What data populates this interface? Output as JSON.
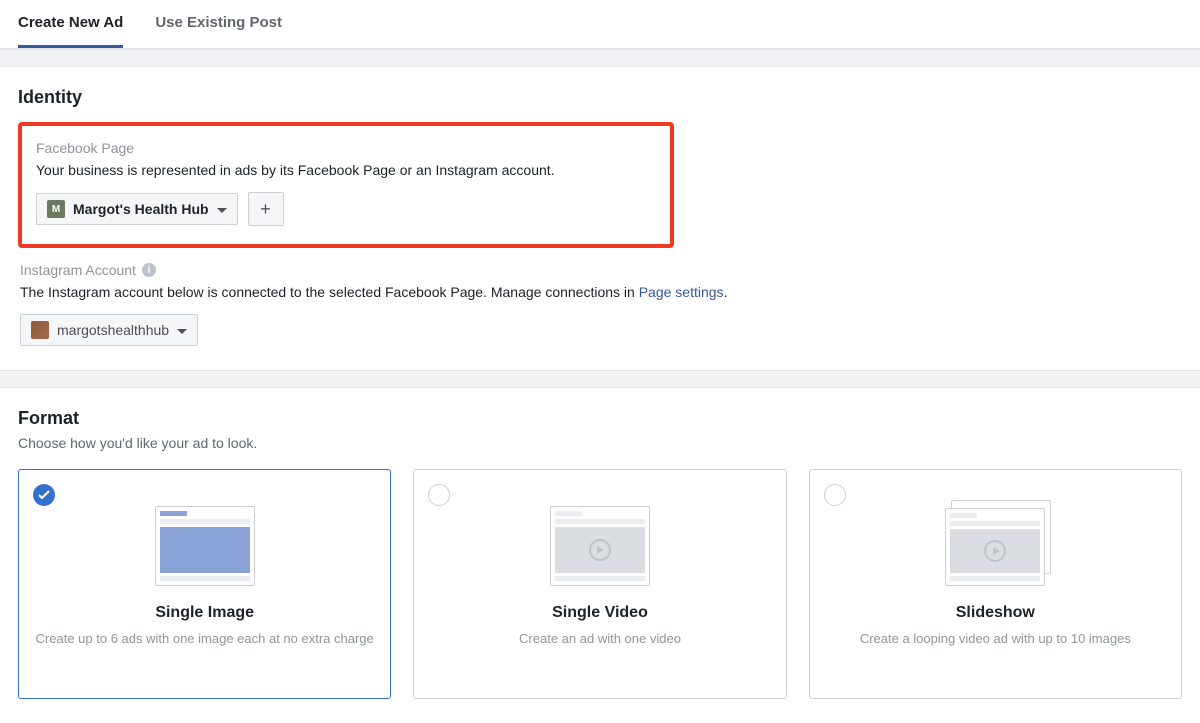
{
  "tabs": {
    "create": "Create New Ad",
    "existing": "Use Existing Post"
  },
  "identity": {
    "title": "Identity",
    "fbPage": {
      "label": "Facebook Page",
      "desc": "Your business is represented in ads by its Facebook Page or an Instagram account.",
      "selected": "Margot's Health Hub",
      "avatarLetter": "M"
    },
    "instagram": {
      "label": "Instagram Account",
      "descPrefix": "The Instagram account below is connected to the selected Facebook Page. Manage connections in ",
      "linkText": "Page settings",
      "descSuffix": ".",
      "selected": "margotshealthhub"
    }
  },
  "format": {
    "title": "Format",
    "subtitle": "Choose how you'd like your ad to look.",
    "cards": [
      {
        "title": "Single Image",
        "desc": "Create up to 6 ads with one image each at no extra charge"
      },
      {
        "title": "Single Video",
        "desc": "Create an ad with one video"
      },
      {
        "title": "Slideshow",
        "desc": "Create a looping video ad with up to 10 images"
      }
    ]
  }
}
